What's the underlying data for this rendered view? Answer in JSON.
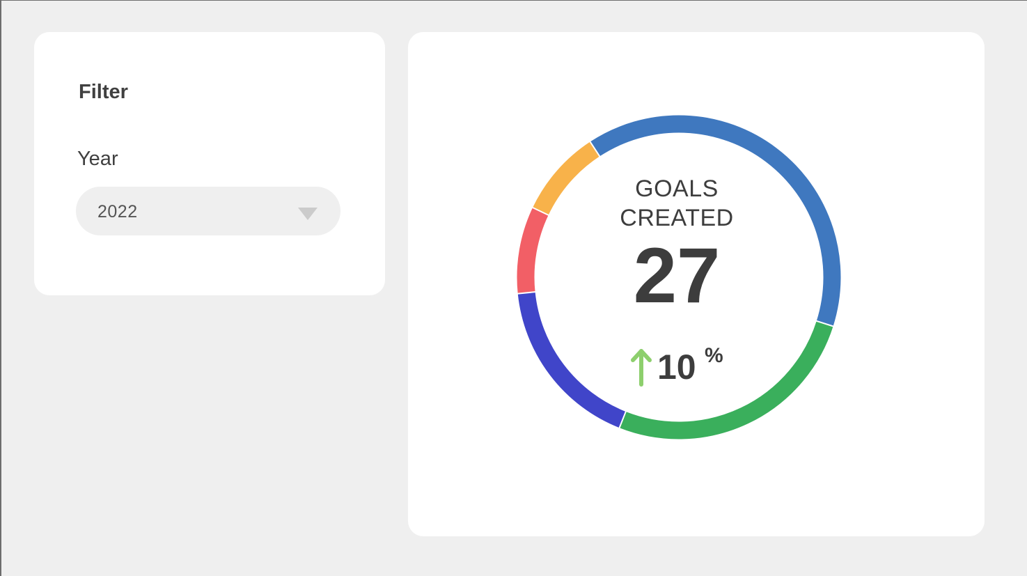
{
  "filter": {
    "title": "Filter",
    "year_label": "Year",
    "year_value": "2022"
  },
  "kpi": {
    "label_line1": "GOALS",
    "label_line2": "CREATED",
    "value": "27",
    "change_value": "10",
    "change_unit": "%",
    "change_direction": "up",
    "change_color": "#8dcf6d"
  },
  "chart_data": {
    "type": "pie",
    "variant": "donut",
    "values": [
      9,
      6,
      4,
      2,
      2
    ],
    "colors": [
      "#3f78bf",
      "#3aaf5c",
      "#4045c9",
      "#f25f66",
      "#f8b24a"
    ]
  }
}
